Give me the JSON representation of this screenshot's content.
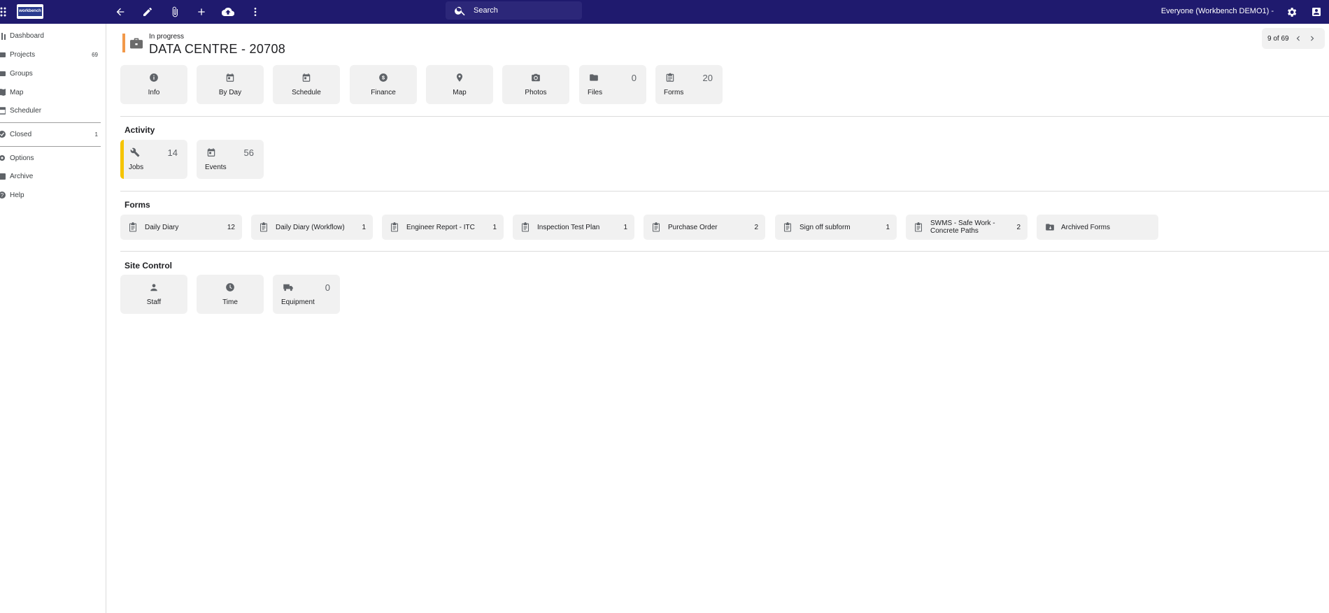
{
  "topbar": {
    "logo_text": "workbench",
    "search_placeholder": "Search",
    "user_label": "Everyone (Workbench DEMO1) -",
    "icons": [
      "apps-icon",
      "back-arrow-icon",
      "pencil-icon",
      "paperclip-icon",
      "plus-icon",
      "cloud-upload-icon",
      "more-vert-icon",
      "gear-icon",
      "account-box-icon"
    ]
  },
  "sidebar": {
    "items": [
      {
        "label": "Dashboard",
        "icon": "dashboard-icon",
        "count": ""
      },
      {
        "label": "Projects",
        "icon": "projects-icon",
        "count": "69"
      },
      {
        "label": "Groups",
        "icon": "groups-icon",
        "count": ""
      },
      {
        "label": "Map",
        "icon": "map-icon",
        "count": ""
      },
      {
        "label": "Scheduler",
        "icon": "calendar-icon",
        "count": ""
      },
      {
        "label": "Closed",
        "icon": "closed-icon",
        "count": "1"
      },
      {
        "label": "Options",
        "icon": "gear-icon",
        "count": ""
      },
      {
        "label": "Archive",
        "icon": "archive-icon",
        "count": ""
      },
      {
        "label": "Help",
        "icon": "help-icon",
        "count": ""
      }
    ]
  },
  "project": {
    "status": "In progress",
    "title": "DATA CENTRE - 20708",
    "status_color": "#f2994a",
    "pager": "9 of 69"
  },
  "top_tiles": [
    {
      "label": "Info",
      "icon": "info-icon",
      "count": ""
    },
    {
      "label": "By Day",
      "icon": "calendar-icon",
      "count": ""
    },
    {
      "label": "Schedule",
      "icon": "calendar-icon",
      "count": ""
    },
    {
      "label": "Finance",
      "icon": "dollar-icon",
      "count": ""
    },
    {
      "label": "Map",
      "icon": "map-pin-icon",
      "count": ""
    },
    {
      "label": "Photos",
      "icon": "camera-icon",
      "count": ""
    },
    {
      "label": "Files",
      "icon": "folder-icon",
      "count": "0"
    },
    {
      "label": "Forms",
      "icon": "clipboard-icon",
      "count": "20"
    }
  ],
  "activity": {
    "title": "Activity",
    "tiles": [
      {
        "label": "Jobs",
        "icon": "wrench-icon",
        "count": "14"
      },
      {
        "label": "Events",
        "icon": "calendar-icon",
        "count": "56"
      }
    ]
  },
  "forms": {
    "title": "Forms",
    "chips": [
      {
        "label": "Daily Diary",
        "count": "12"
      },
      {
        "label": "Daily Diary (Workflow)",
        "count": "1"
      },
      {
        "label": "Engineer Report - ITC",
        "count": "1"
      },
      {
        "label": "Inspection Test Plan",
        "count": "1"
      },
      {
        "label": "Purchase Order",
        "count": "2"
      },
      {
        "label": "Sign off subform",
        "count": "1"
      },
      {
        "label": "SWMS - Safe Work - Concrete Paths",
        "count": "2"
      },
      {
        "label": "Archived Forms",
        "count": ""
      }
    ]
  },
  "site_control": {
    "title": "Site Control",
    "tiles": [
      {
        "label": "Staff",
        "icon": "person-icon",
        "count": ""
      },
      {
        "label": "Time",
        "icon": "clock-icon",
        "count": ""
      },
      {
        "label": "Equipment",
        "icon": "truck-icon",
        "count": "0"
      }
    ]
  }
}
